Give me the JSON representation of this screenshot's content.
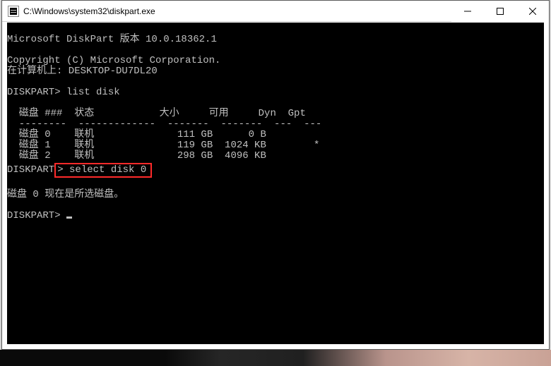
{
  "window": {
    "title": "C:\\Windows\\system32\\diskpart.exe"
  },
  "terminal": {
    "version_line": "Microsoft DiskPart 版本 10.0.18362.1",
    "copyright_line": "Copyright (C) Microsoft Corporation.",
    "computer_line": "在计算机上: DESKTOP-DU7DL20",
    "prompt1": "DISKPART> list disk",
    "header": "  磁盘 ###  状态           大小     可用     Dyn  Gpt",
    "divider": "  --------  -------------  -------  -------  ---  ---",
    "disks": [
      {
        "row": "  磁盘 0    联机              111 GB      0 B        "
      },
      {
        "row": "  磁盘 1    联机              119 GB  1024 KB        *"
      },
      {
        "row": "  磁盘 2    联机              298 GB  4096 KB        "
      }
    ],
    "prompt2_prefix": "DISKPART",
    "prompt2_cmd": "> select disk 0",
    "result_line": "磁盘 0 现在是所选磁盘。",
    "prompt3": "DISKPART> "
  }
}
